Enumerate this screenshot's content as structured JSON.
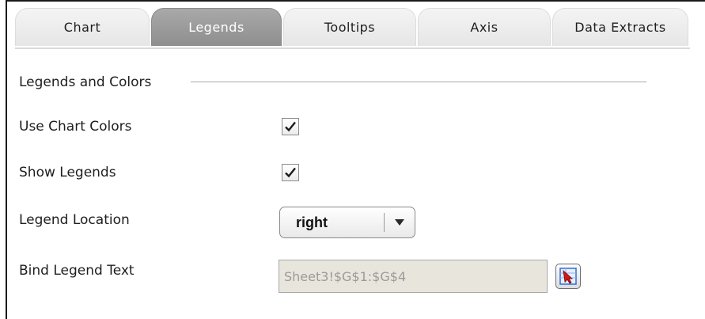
{
  "tabs": [
    {
      "label": "Chart",
      "active": false
    },
    {
      "label": "Legends",
      "active": true
    },
    {
      "label": "Tooltips",
      "active": false
    },
    {
      "label": "Axis",
      "active": false
    },
    {
      "label": "Data Extracts",
      "active": false
    }
  ],
  "section": {
    "title": "Legends and Colors"
  },
  "use_chart_colors": {
    "label": "Use Chart Colors",
    "checked": true
  },
  "show_legends": {
    "label": "Show Legends",
    "checked": true
  },
  "legend_location": {
    "label": "Legend Location",
    "value": "right",
    "icon": "chevron-down-icon"
  },
  "bind_legend_text": {
    "label": "Bind Legend Text",
    "value": "Sheet3!$G$1:$G$4",
    "picker_icon": "range-select-icon"
  },
  "colors": {
    "active_tab": "#999999",
    "field_bg": "#e8e6dc",
    "picker_arrow": "#cc1a1a",
    "picker_blue": "#2f6fd6"
  }
}
